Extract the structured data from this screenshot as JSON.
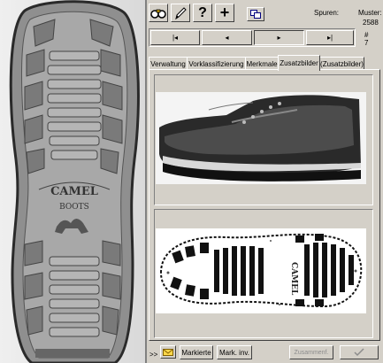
{
  "toolbar": {
    "icons": [
      "binoculars-icon",
      "pencil-icon",
      "help-icon",
      "plus-icon",
      "copy-icon"
    ],
    "help_label": "?",
    "plus_label": "+"
  },
  "stats": {
    "traces_label": "Spuren:",
    "pattern_label": "Muster:",
    "pattern_value": "2588",
    "hash_label": "#",
    "hash_value": "7"
  },
  "nav": {
    "first": "|◂",
    "prev": "◂",
    "next": "▸",
    "last": "▸|"
  },
  "tabs": [
    {
      "label": "Verwaltung"
    },
    {
      "label": "Vorklassifizierung"
    },
    {
      "label": "Merkmale"
    },
    {
      "label": "Zusatzbilder",
      "active": true
    },
    {
      "label": "(Zusatzbilder)"
    }
  ],
  "left_image": {
    "brand": "CAMEL",
    "subbrand": "BOOTS"
  },
  "bottom": {
    "arrows": ">>",
    "mark_label": "Markierte",
    "mark_inv_label": "Mark. inv.",
    "combine_label": "Zusammenf."
  }
}
